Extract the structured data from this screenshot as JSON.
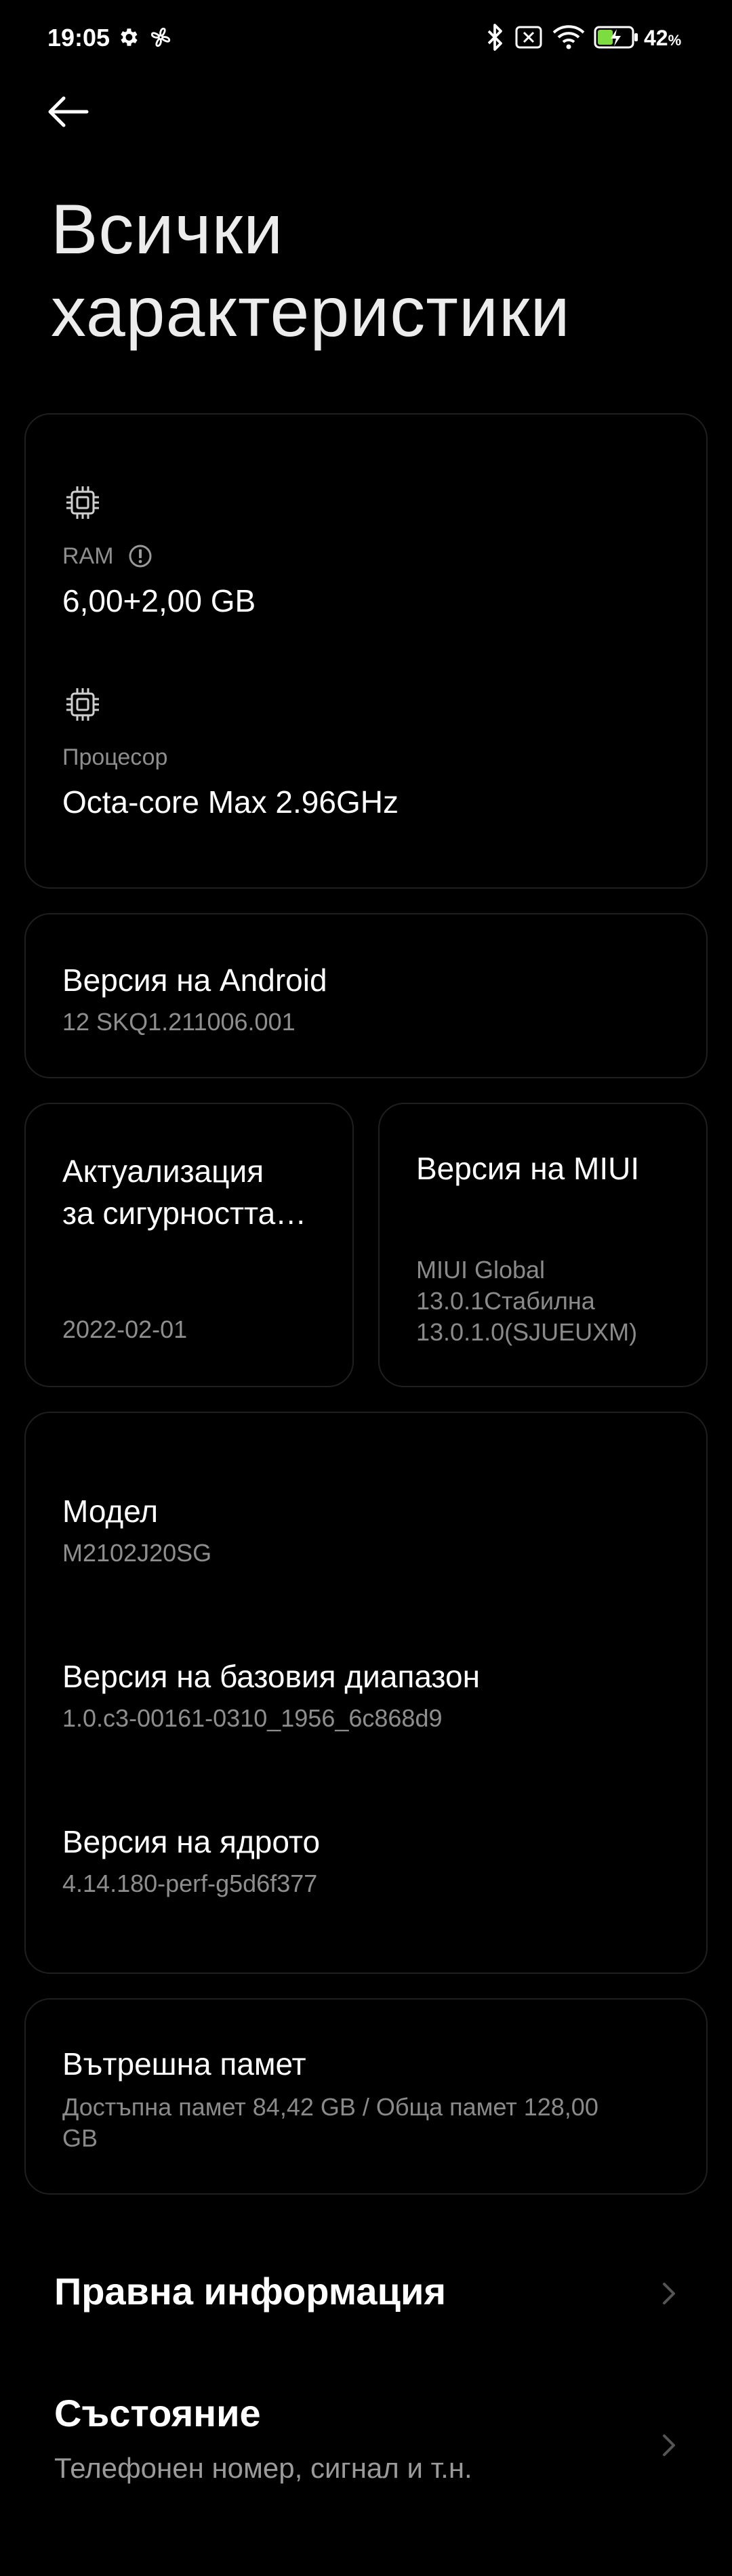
{
  "status_bar": {
    "time": "19:05",
    "battery_percent": "42",
    "battery_unit": "%"
  },
  "header": {
    "title_line1": "Всички",
    "title_line2": "характеристики"
  },
  "specs_card": {
    "ram_label": "RAM",
    "ram_value": "6,00+2,00 GB",
    "cpu_label": "Процесор",
    "cpu_value": "Octa-core Max 2.96GHz"
  },
  "android_card": {
    "title": "Версия на Android",
    "value": "12 SKQ1.211006.001"
  },
  "security_card": {
    "title_line1": "Актуализация",
    "title_line2": "за сигурността…",
    "value": "2022-02-01"
  },
  "miui_card": {
    "title": "Версия на MIUI",
    "value_line1": "MIUI Global",
    "value_line2": "13.0.1Стабилна",
    "value_line3": "13.0.1.0(SJUEUXM)"
  },
  "device_card": {
    "model_title": "Модел",
    "model_value": "M2102J20SG",
    "baseband_title": "Версия на базовия диапазон",
    "baseband_value": "1.0.c3-00161-0310_1956_6c868d9",
    "kernel_title": "Версия на ядрото",
    "kernel_value": "4.14.180-perf-g5d6f377"
  },
  "storage_card": {
    "title": "Вътрешна памет",
    "value_line1": "Достъпна памет  84,42 GB / Обща памет  128,00",
    "value_line2": "GB"
  },
  "list": {
    "legal_title": "Правна информация",
    "status_title": "Състояние",
    "status_sub": "Телефонен номер, сигнал и т.н."
  },
  "colors": {
    "background": "#000000",
    "card_border": "#1f1f1f",
    "secondary_text": "#8a8a8a"
  },
  "icons": {
    "settings": "gear-icon",
    "fan": "fan-icon",
    "bluetooth": "bluetooth-icon",
    "sim": "no-sim-icon",
    "wifi": "wifi-icon",
    "battery": "battery-charging-icon",
    "back": "back-arrow-icon",
    "chip": "chip-icon",
    "info": "info-icon",
    "chevron": "chevron-right-icon"
  }
}
